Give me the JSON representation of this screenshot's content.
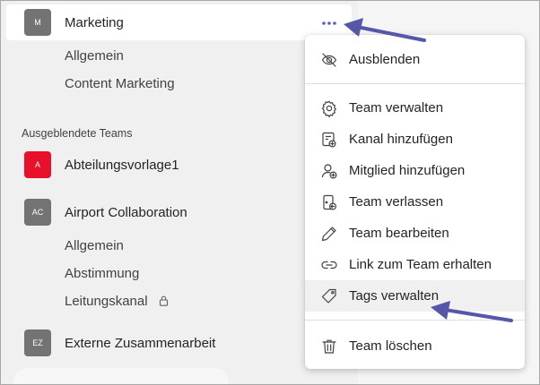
{
  "teams_list": {
    "selected_team": {
      "initials": "M",
      "name": "Marketing"
    },
    "channels": [
      "Allgemein",
      "Content Marketing"
    ],
    "hidden_section_label": "Ausgeblendete Teams",
    "hidden_teams": [
      {
        "initials": "A",
        "name": "Abteilungsvorlage1",
        "color": "#e8102a"
      },
      {
        "initials": "AC",
        "name": "Airport Collaboration",
        "color": "#737373",
        "channels": [
          "Allgemein",
          "Abstimmung",
          "Leitungskanal"
        ]
      },
      {
        "initials": "EZ",
        "name": "Externe Zusammenarbeit",
        "color": "#737373"
      }
    ],
    "more_button": "•••"
  },
  "context_menu": {
    "items": [
      {
        "label": "Ausblenden",
        "icon": "eye-off-icon"
      },
      {
        "label": "Team verwalten",
        "icon": "gear-icon"
      },
      {
        "label": "Kanal hinzufügen",
        "icon": "add-channel-icon"
      },
      {
        "label": "Mitglied hinzufügen",
        "icon": "add-member-icon"
      },
      {
        "label": "Team verlassen",
        "icon": "leave-team-icon"
      },
      {
        "label": "Team bearbeiten",
        "icon": "pencil-icon"
      },
      {
        "label": "Link zum Team erhalten",
        "icon": "link-icon"
      },
      {
        "label": "Tags verwalten",
        "icon": "tag-icon"
      },
      {
        "label": "Team löschen",
        "icon": "trash-icon"
      }
    ],
    "hovered_item": "Tags verwalten"
  },
  "colors": {
    "accent": "#6264a7",
    "arrow": "#5558a8",
    "avatar_gray": "#737373",
    "avatar_red": "#e8102a"
  }
}
